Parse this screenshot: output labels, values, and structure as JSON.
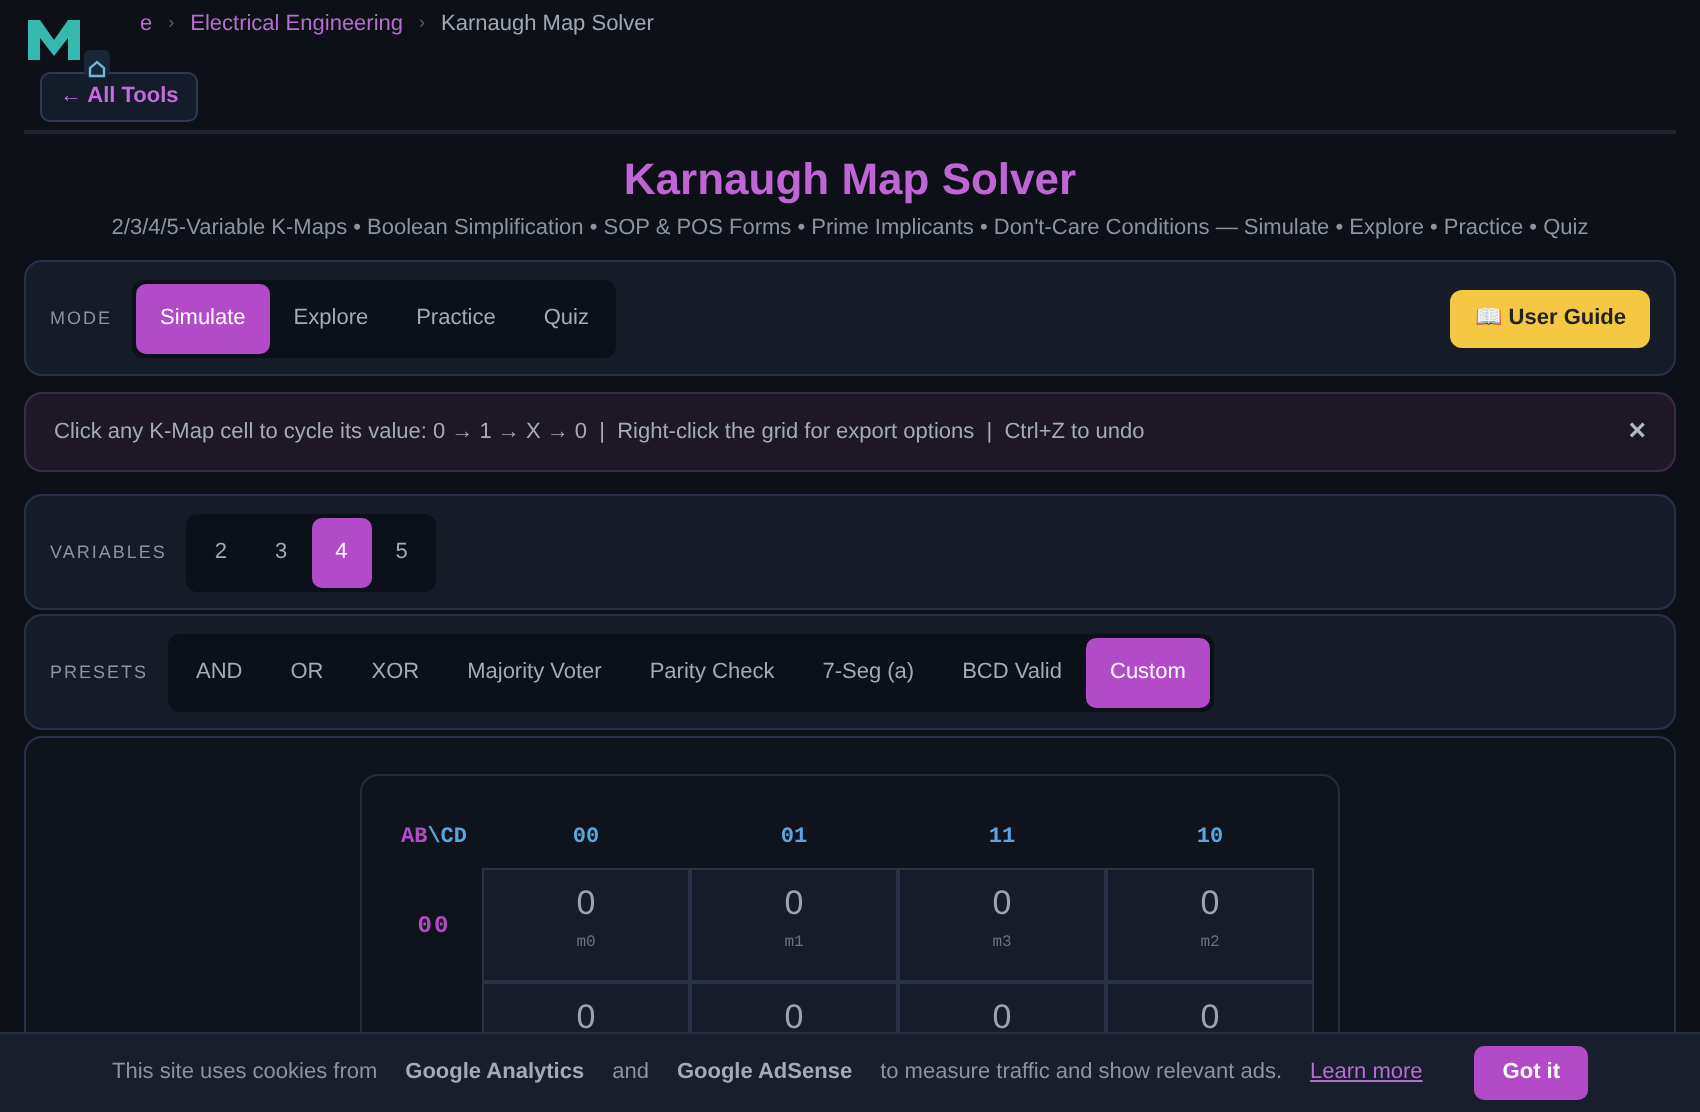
{
  "breadcrumb": [
    {
      "label": "e",
      "current": false
    },
    {
      "label": "Electrical Engineering",
      "current": false
    },
    {
      "label": "Karnaugh Map Solver",
      "current": true
    }
  ],
  "breadcrumb_separator": "›",
  "back_button": "← All Tools",
  "title": "Karnaugh Map Solver",
  "subtitle": "2/3/4/5-Variable K-Maps • Boolean Simplification • SOP & POS Forms • Prime Implicants • Don't-Care Conditions — Simulate • Explore • Practice • Quiz",
  "mode": {
    "label": "MODE",
    "options": [
      {
        "label": "Simulate",
        "selected": true
      },
      {
        "label": "Explore",
        "selected": false
      },
      {
        "label": "Practice",
        "selected": false
      },
      {
        "label": "Quiz",
        "selected": false
      }
    ],
    "guide_button": "📖 User Guide"
  },
  "hint": {
    "text": "Click any K-Map cell to cycle its value: 0 → 1 → X → 0  |  Right-click the grid for export options  |  Ctrl+Z to undo",
    "close": "×"
  },
  "variables": {
    "label": "VARIABLES",
    "options": [
      {
        "label": "2",
        "selected": false
      },
      {
        "label": "3",
        "selected": false
      },
      {
        "label": "4",
        "selected": true
      },
      {
        "label": "5",
        "selected": false
      }
    ]
  },
  "presets": {
    "label": "PRESETS",
    "options": [
      {
        "label": "AND",
        "selected": false
      },
      {
        "label": "OR",
        "selected": false
      },
      {
        "label": "XOR",
        "selected": false
      },
      {
        "label": "Majority Voter",
        "selected": false
      },
      {
        "label": "Parity Check",
        "selected": false
      },
      {
        "label": "7-Seg (a)",
        "selected": false
      },
      {
        "label": "BCD Valid",
        "selected": false
      },
      {
        "label": "Custom",
        "selected": true
      }
    ]
  },
  "kmap": {
    "row_vars": "AB",
    "corner_separator": "\\",
    "col_vars": "CD",
    "columns": [
      "00",
      "01",
      "11",
      "10"
    ],
    "rows": [
      {
        "label": "00",
        "cells": [
          {
            "value": "0",
            "minterm": "m0"
          },
          {
            "value": "0",
            "minterm": "m1"
          },
          {
            "value": "0",
            "minterm": "m3"
          },
          {
            "value": "0",
            "minterm": "m2"
          }
        ]
      },
      {
        "cells": [
          {
            "value": "0"
          },
          {
            "value": "0"
          },
          {
            "value": "0"
          },
          {
            "value": "0"
          }
        ]
      }
    ]
  },
  "cookie_banner": {
    "parts": [
      "This site uses cookies from",
      "Google Analytics",
      "and",
      "Google AdSense",
      "to measure traffic and show relevant ads."
    ],
    "link": "Learn more",
    "button": "Got it"
  }
}
